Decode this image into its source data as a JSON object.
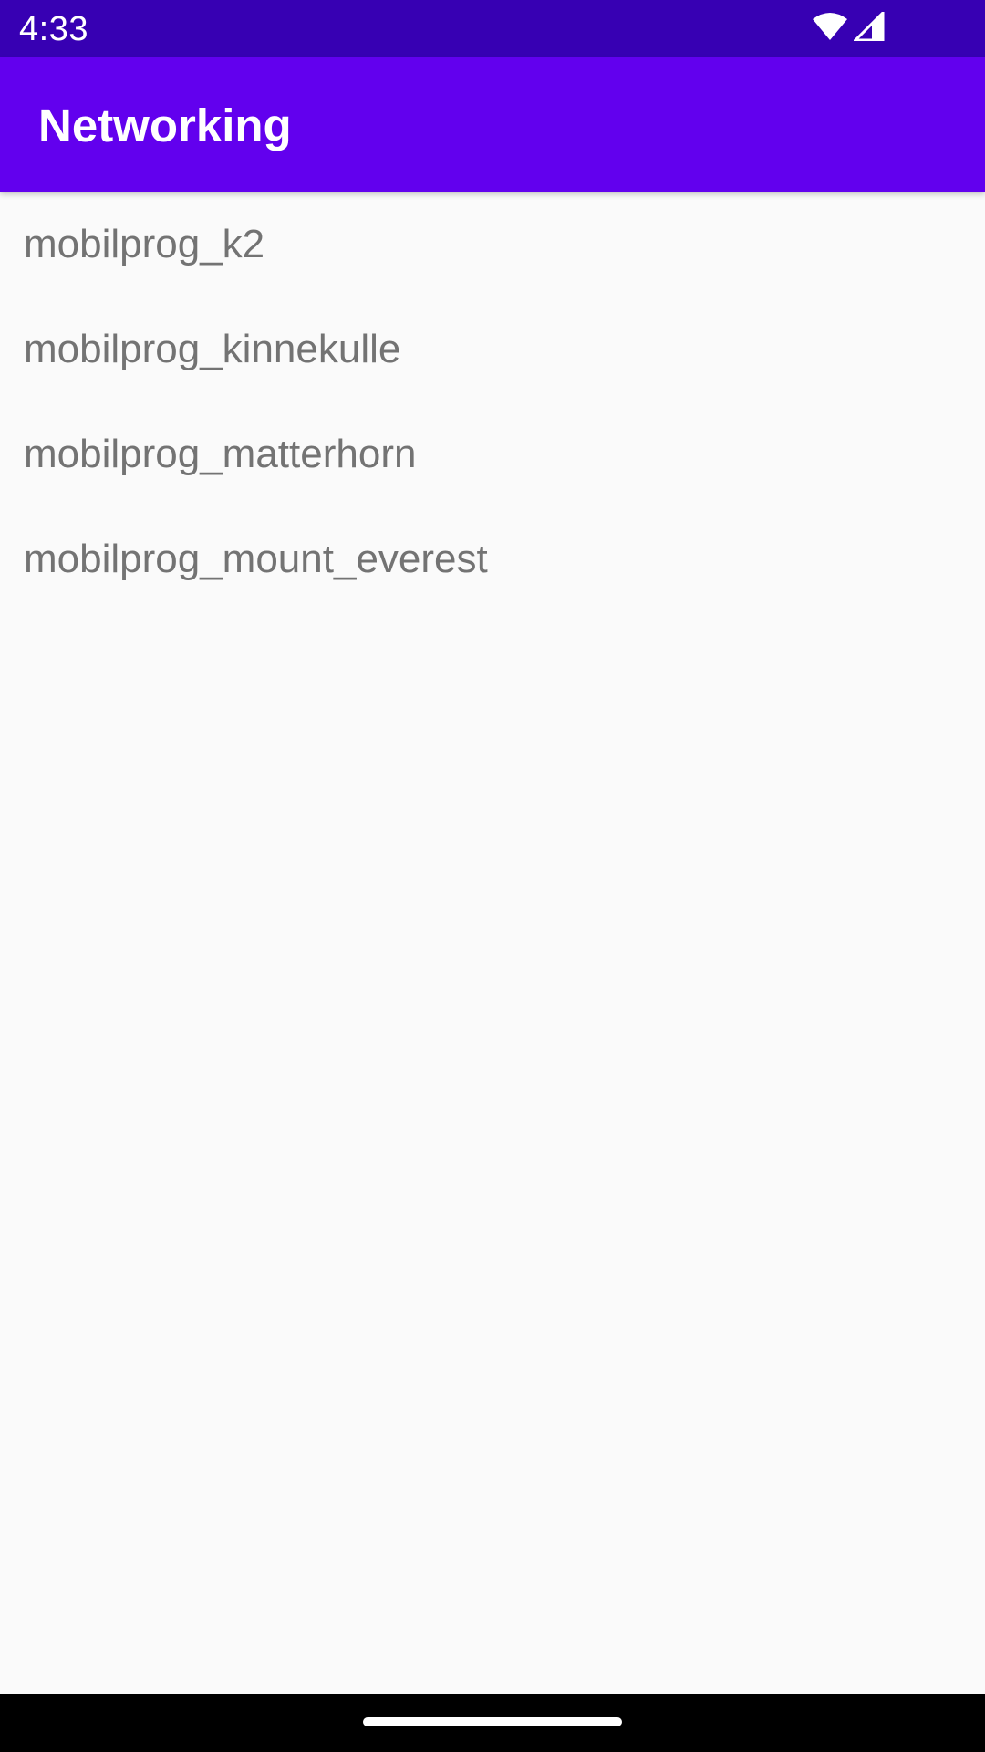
{
  "status_bar": {
    "time": "4:33",
    "icons": [
      "wifi-icon",
      "cellular-signal-icon"
    ]
  },
  "app_bar": {
    "title": "Networking"
  },
  "list": {
    "items": [
      {
        "label": "mobilprog_k2"
      },
      {
        "label": "mobilprog_kinnekulle"
      },
      {
        "label": "mobilprog_matterhorn"
      },
      {
        "label": "mobilprog_mount_everest"
      }
    ]
  },
  "colors": {
    "status_bar": "#3700b3",
    "app_bar": "#6200ee",
    "background": "#fafafa",
    "list_text": "#737373",
    "nav_bar": "#000000"
  }
}
